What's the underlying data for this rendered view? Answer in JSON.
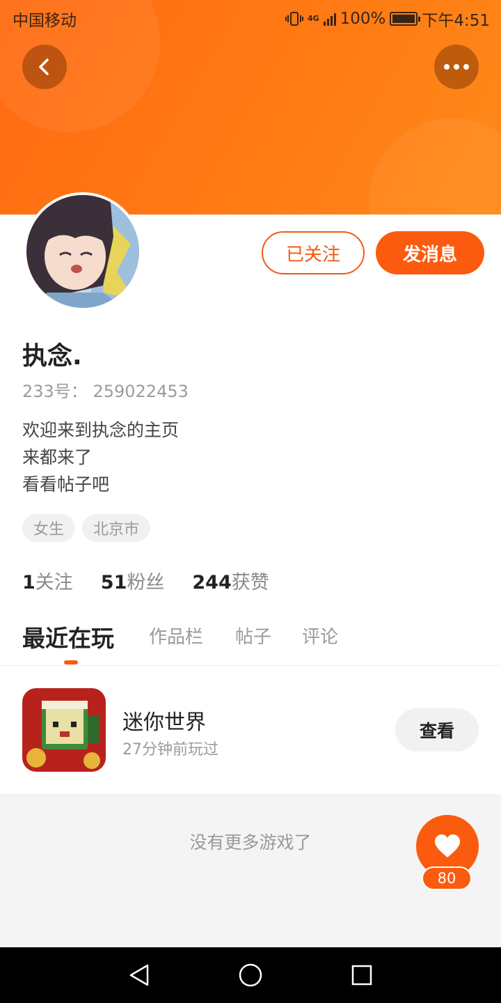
{
  "status_bar": {
    "carrier": "中国移动",
    "network": "4G",
    "battery": "100%",
    "time": "下午4:51"
  },
  "header": {
    "back_icon": "chevron-left-icon",
    "more_icon": "more-dots-icon",
    "colors": {
      "gradient_start": "#ff6a12",
      "gradient_end": "#ff8a1a"
    }
  },
  "profile": {
    "follow_label": "已关注",
    "message_label": "发消息",
    "username": "执念.",
    "id_label": "233号：",
    "id_value": "259022453",
    "bio_lines": [
      "欢迎来到执念的主页",
      "来都来了",
      "看看帖子吧"
    ],
    "tags": [
      "女生",
      "北京市"
    ]
  },
  "stats": [
    {
      "value": "1",
      "label": "关注"
    },
    {
      "value": "51",
      "label": "粉丝"
    },
    {
      "value": "244",
      "label": "获赞"
    }
  ],
  "tabs": [
    {
      "label": "最近在玩",
      "active": true
    },
    {
      "label": "作品栏",
      "active": false
    },
    {
      "label": "帖子",
      "active": false
    },
    {
      "label": "评论",
      "active": false
    }
  ],
  "recent_game": {
    "name": "迷你世界",
    "played": "27分钟前玩过",
    "view_label": "查看"
  },
  "footer": {
    "no_more": "没有更多游戏了"
  },
  "like": {
    "count": "80",
    "icon": "heart-icon"
  },
  "navbar": {
    "icons": [
      "back-triangle-icon",
      "home-circle-icon",
      "recents-square-icon"
    ]
  },
  "accent_color": "#fb5b0e"
}
